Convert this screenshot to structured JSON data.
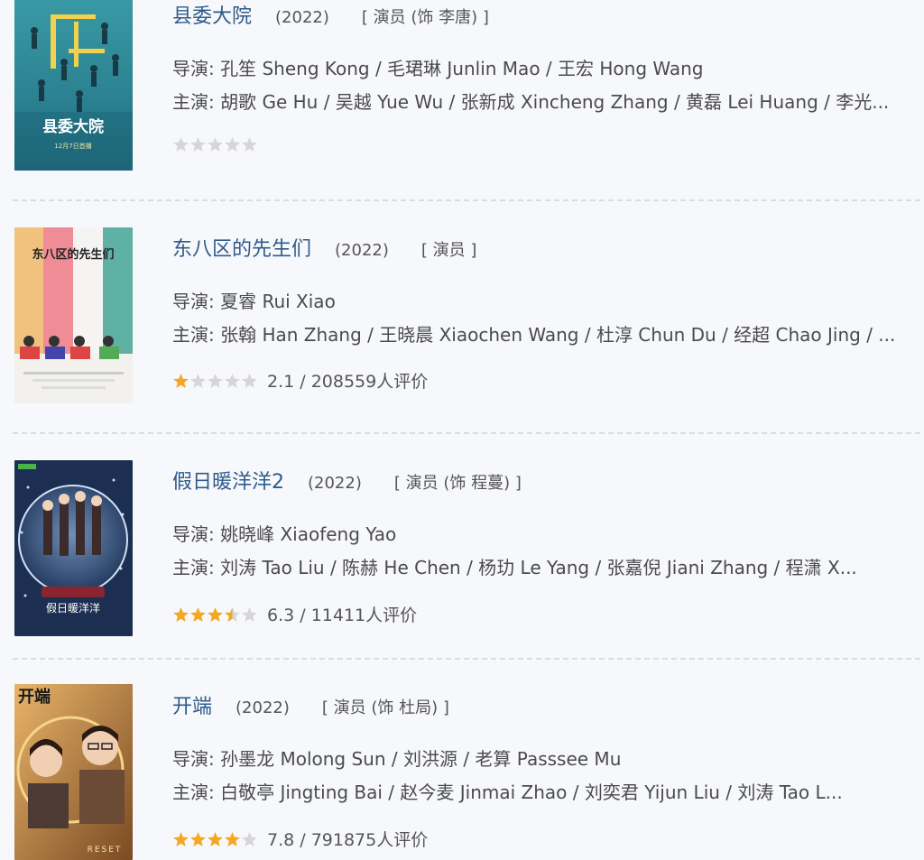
{
  "items": [
    {
      "title": "县委大院",
      "year": "(2022)",
      "role": "[ 演员 (饰 李唐) ]",
      "director_label": "导演:",
      "directors": "孔笙 Sheng Kong / 毛珺琳 Junlin Mao / 王宏 Hong Wang",
      "cast_label": "主演:",
      "cast": "胡歌 Ge Hu / 吴越 Yue Wu / 张新成 Xincheng Zhang / 黄磊 Lei Huang / 李光...",
      "stars": 0,
      "rating_text": "",
      "poster_caption": "县委大院",
      "poster_subcaption": "12月7日首播"
    },
    {
      "title": "东八区的先生们",
      "year": "(2022)",
      "role": "[ 演员 ]",
      "director_label": "导演:",
      "directors": "夏睿 Rui Xiao",
      "cast_label": "主演:",
      "cast": "张翰 Han Zhang / 王晓晨 Xiaochen Wang / 杜淳 Chun Du / 经超 Chao Jing / ...",
      "stars": 1,
      "rating_text": "2.1 / 208559人评价",
      "poster_caption": "东八区的先生们",
      "poster_subcaption": ""
    },
    {
      "title": "假日暖洋洋2",
      "year": "(2022)",
      "role": "[ 演员 (饰 程蔓) ]",
      "director_label": "导演:",
      "directors": "姚晓峰 Xiaofeng Yao",
      "cast_label": "主演:",
      "cast": "刘涛 Tao Liu / 陈赫 He Chen / 杨玏 Le Yang / 张嘉倪 Jiani Zhang / 程潇 X...",
      "stars": 3.5,
      "rating_text": "6.3 / 11411人评价",
      "poster_caption": "假日暖洋洋",
      "poster_subcaption": ""
    },
    {
      "title": "开端",
      "year": "(2022)",
      "role": "[ 演员 (饰 杜局) ]",
      "director_label": "导演:",
      "directors": "孙墨龙 Molong Sun / 刘洪源 / 老算 Passsee Mu",
      "cast_label": "主演:",
      "cast": "白敬亭 Jingting Bai / 赵今麦 Jinmai Zhao / 刘奕君 Yijun Liu / 刘涛 Tao L...",
      "stars": 4,
      "rating_text": "7.8 / 791875人评价",
      "poster_caption": "开端",
      "poster_subcaption": "RESET"
    }
  ],
  "colors": {
    "title": "#2f5b8a",
    "star_on": "#f5a623",
    "star_off": "#d6d6d6"
  }
}
